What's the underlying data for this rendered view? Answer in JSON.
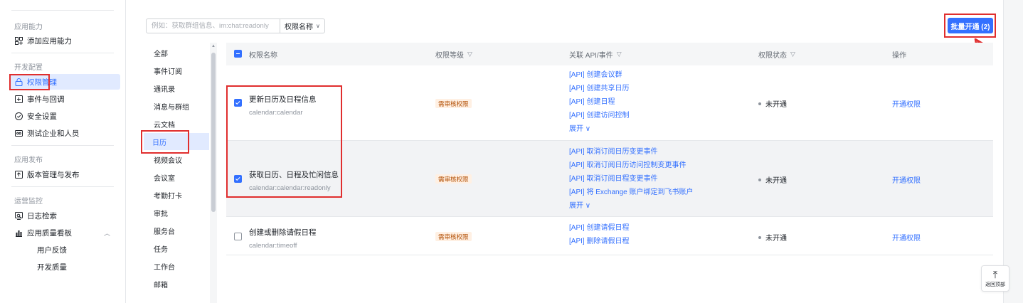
{
  "nav": {
    "group_app_ability": "应用能力",
    "add_app_ability": "添加应用能力",
    "group_dev_config": "开发配置",
    "items_dev": [
      {
        "label": "权限管理",
        "icon": "lock-icon"
      },
      {
        "label": "事件与回调",
        "icon": "event-icon"
      },
      {
        "label": "安全设置",
        "icon": "shield-icon"
      },
      {
        "label": "测试企业和人员",
        "icon": "test-icon"
      }
    ],
    "group_publish": "应用发布",
    "version_manage": "版本管理与发布",
    "group_ops": "运营监控",
    "log_search": "日志检索",
    "quality_board": "应用质量看板",
    "user_feedback": "用户反馈",
    "dev_quality": "开发质量"
  },
  "search": {
    "placeholder": "例如：获取群组信息、im:chat:readonly",
    "select_label": "权限名称"
  },
  "batch_button": "批量开通 (2)",
  "categories": [
    "全部",
    "事件订阅",
    "通讯录",
    "消息与群组",
    "云文档",
    "日历",
    "视频会议",
    "会议室",
    "考勤打卡",
    "审批",
    "服务台",
    "任务",
    "工作台",
    "邮箱"
  ],
  "active_category": "日历",
  "table": {
    "headers": {
      "name": "权限名称",
      "level": "权限等级",
      "api": "关联 API/事件",
      "status": "权限状态",
      "op": "操作"
    },
    "rows": [
      {
        "name": "更新日历及日程信息",
        "code": "calendar:calendar",
        "level": "需审核权限",
        "apis": [
          "[API] 创建会议群",
          "[API] 创建共享日历",
          "[API] 创建日程",
          "[API] 创建访问控制"
        ],
        "expand": "展开",
        "status": "未开通",
        "op": "开通权限",
        "checked": true
      },
      {
        "name": "获取日历、日程及忙闲信息",
        "code": "calendar:calendar:readonly",
        "level": "需审核权限",
        "apis": [
          "[API] 取消订阅日历变更事件",
          "[API] 取消订阅日历访问控制变更事件",
          "[API] 取消订阅日程变更事件",
          "[API] 将 Exchange 账户绑定到飞书账户"
        ],
        "expand": "展开",
        "status": "未开通",
        "op": "开通权限",
        "checked": true
      },
      {
        "name": "创建或删除请假日程",
        "code": "calendar:timeoff",
        "level": "需审核权限",
        "apis": [
          "[API] 创建请假日程",
          "[API] 删除请假日程"
        ],
        "expand": "",
        "status": "未开通",
        "op": "开通权限",
        "checked": false
      }
    ]
  },
  "back_to_top": "返回顶部",
  "colors": {
    "accent": "#3370ff",
    "annotation": "#e02e2e",
    "badge_bg": "#fff0e3",
    "badge_text": "#b04c00"
  }
}
